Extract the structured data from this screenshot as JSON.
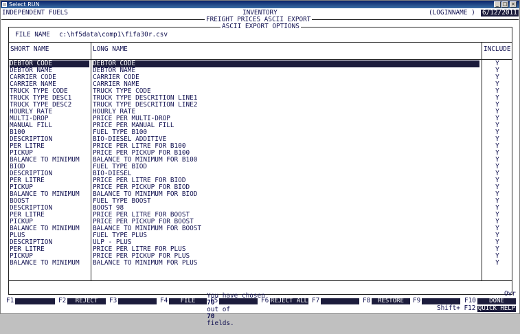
{
  "window": {
    "title": "Select RUN"
  },
  "header": {
    "company": "INDEPENDENT FUELS",
    "module": "INVENTORY",
    "screen": "FREIGHT PRICES ASCII EXPORT",
    "section": "ASCII EXPORT OPTIONS",
    "login": "(LOGINNAME )",
    "date": "6/12/2011"
  },
  "file": {
    "label": "FILE NAME",
    "value": "c:\\hf5data\\comp1\\fifa30r.csv"
  },
  "columns": {
    "short": "SHORT NAME",
    "long": "LONG NAME",
    "include": "INCLUDE"
  },
  "rows": [
    {
      "short": "DEBTOR CODE",
      "long": "DEBTOR CODE",
      "include": "Y"
    },
    {
      "short": "DEBTOR NAME",
      "long": "DEBTOR NAME",
      "include": "Y"
    },
    {
      "short": "CARRIER CODE",
      "long": "CARRIER CODE",
      "include": "Y"
    },
    {
      "short": "CARRIER NAME",
      "long": "CARRIER NAME",
      "include": "Y"
    },
    {
      "short": "TRUCK TYPE CODE",
      "long": "TRUCK TYPE CODE",
      "include": "Y"
    },
    {
      "short": "TRUCK TYPE DESC1",
      "long": "TRUCK TYPE DESCRITION LINE1",
      "include": "Y"
    },
    {
      "short": "TRUCK TYPE DESC2",
      "long": "TRUCK TYPE DESCRITION LINE2",
      "include": "Y"
    },
    {
      "short": "HOURLY RATE",
      "long": "HOURLY RATE",
      "include": "Y"
    },
    {
      "short": "MULTI-DROP",
      "long": "PRICE PER MULTI-DROP",
      "include": "Y"
    },
    {
      "short": "MANUAL FILL",
      "long": "PRICE PER MANUAL FILL",
      "include": "Y"
    },
    {
      "short": "B100",
      "long": "FUEL TYPE B100",
      "include": "Y"
    },
    {
      "short": "DESCRIPTION",
      "long": "BIO-DIESEL ADDITIVE",
      "include": "Y"
    },
    {
      "short": "PER LITRE",
      "long": "PRICE PER LITRE FOR B100",
      "include": "Y"
    },
    {
      "short": "PICKUP",
      "long": "PRICE PER PICKUP FOR B100",
      "include": "Y"
    },
    {
      "short": "BALANCE TO MINIMUM",
      "long": "BALANCE TO MINIMUM FOR B100",
      "include": "Y"
    },
    {
      "short": "BIOD",
      "long": "FUEL TYPE BIOD",
      "include": "Y"
    },
    {
      "short": "DESCRIPTION",
      "long": "BIO-DIESEL",
      "include": "Y"
    },
    {
      "short": "PER LITRE",
      "long": "PRICE PER LITRE FOR BIOD",
      "include": "Y"
    },
    {
      "short": "PICKUP",
      "long": "PRICE PER PICKUP FOR BIOD",
      "include": "Y"
    },
    {
      "short": "BALANCE TO MINIMUM",
      "long": "BALANCE TO MINIMUM FOR BIOD",
      "include": "Y"
    },
    {
      "short": "BOOST",
      "long": "FUEL TYPE BOOST",
      "include": "Y"
    },
    {
      "short": "DESCRIPTION",
      "long": "BOOST 98",
      "include": "Y"
    },
    {
      "short": "PER LITRE",
      "long": "PRICE PER LITRE FOR BOOST",
      "include": "Y"
    },
    {
      "short": "PICKUP",
      "long": "PRICE PER PICKUP FOR BOOST",
      "include": "Y"
    },
    {
      "short": "BALANCE TO MINIMUM",
      "long": "BALANCE TO MINIMUM FOR BOOST",
      "include": "Y"
    },
    {
      "short": "PLUS",
      "long": "FUEL TYPE PLUS",
      "include": "Y"
    },
    {
      "short": "DESCRIPTION",
      "long": "ULP - PLUS",
      "include": "Y"
    },
    {
      "short": "PER LITRE",
      "long": "PRICE PER LITRE FOR PLUS",
      "include": "Y"
    },
    {
      "short": "PICKUP",
      "long": "PRICE PER PICKUP FOR PLUS",
      "include": "Y"
    },
    {
      "short": "BALANCE TO MINIMUM",
      "long": "BALANCE TO MINIMUM FOR PLUS",
      "include": "Y"
    }
  ],
  "status": {
    "prefix": "You have chosen",
    "chosen": "70",
    "middle": "out of",
    "total": "70",
    "suffix": "fields."
  },
  "mode": "Ovr",
  "fkeys": [
    {
      "key": "F1",
      "label": ""
    },
    {
      "key": "F2",
      "label": "REJECT"
    },
    {
      "key": "F3",
      "label": ""
    },
    {
      "key": "F4",
      "label": "FILE"
    },
    {
      "key": "F5",
      "label": ""
    },
    {
      "key": "F6",
      "label": "REJECT ALL"
    },
    {
      "key": "F7",
      "label": ""
    },
    {
      "key": "F8",
      "label": "RESTORE"
    },
    {
      "key": "F9",
      "label": ""
    },
    {
      "key": "F10",
      "label": "DONE"
    }
  ],
  "shift_key": {
    "key": "Shift+ F12",
    "label": "QUICK HELP"
  },
  "colors": {
    "highlight": "#1c1c3c",
    "text": "#101050"
  }
}
